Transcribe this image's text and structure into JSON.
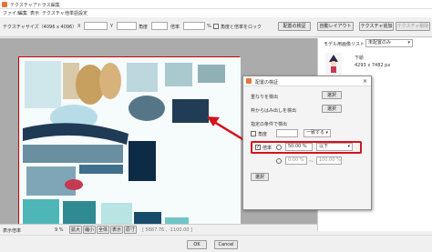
{
  "window": {
    "title": "テクスチャアトラス編集"
  },
  "menu": [
    "ファイル",
    "編集",
    "表示",
    "テクスチャ",
    "他単語設定"
  ],
  "toolbar": {
    "texture_size_label": "テクスチャサイズ（4096 x 4096）",
    "x_label": "X",
    "y_label": "Y",
    "angle_label": "角度",
    "scale_label": "倍率",
    "percent": "%",
    "lock_label": "角度と倍率をロック",
    "verify_button": "配置の検証",
    "auto_layout_button": "自動レイアウト",
    "texture_add_button": "テクスチャ追加",
    "texture_delete_button": "テクスチャ削除"
  },
  "right_panel": {
    "list_label": "モデル用画像リスト",
    "list_value": "未配置のみ",
    "item_name": "下絵",
    "item_size": "4293 x 7482 px"
  },
  "statusbar": {
    "label": "表示倍率",
    "value": "9 %",
    "buttons": [
      "拡大",
      "縮小",
      "全体",
      "表示",
      "原寸"
    ],
    "coords": "[ 5887.76 , -1100.00 ]"
  },
  "bottom": {
    "ok": "OK",
    "cancel": "Cancel"
  },
  "dialog": {
    "title": "配置の検証",
    "row1": "重なりを検出",
    "row2": "枠からはみ出しを検出",
    "select": "選択",
    "section": "指定の条件で検出",
    "angle_label": "角度",
    "angle_op": "一致する",
    "scale_label": "倍率",
    "scale_value": "50.00 %",
    "scale_op": "以下",
    "range_from": "0.00 %",
    "range_sep": "～",
    "range_to": "100.00 %"
  },
  "colors": {
    "accent": "#d3141c",
    "app_icon": "#e8733a"
  }
}
